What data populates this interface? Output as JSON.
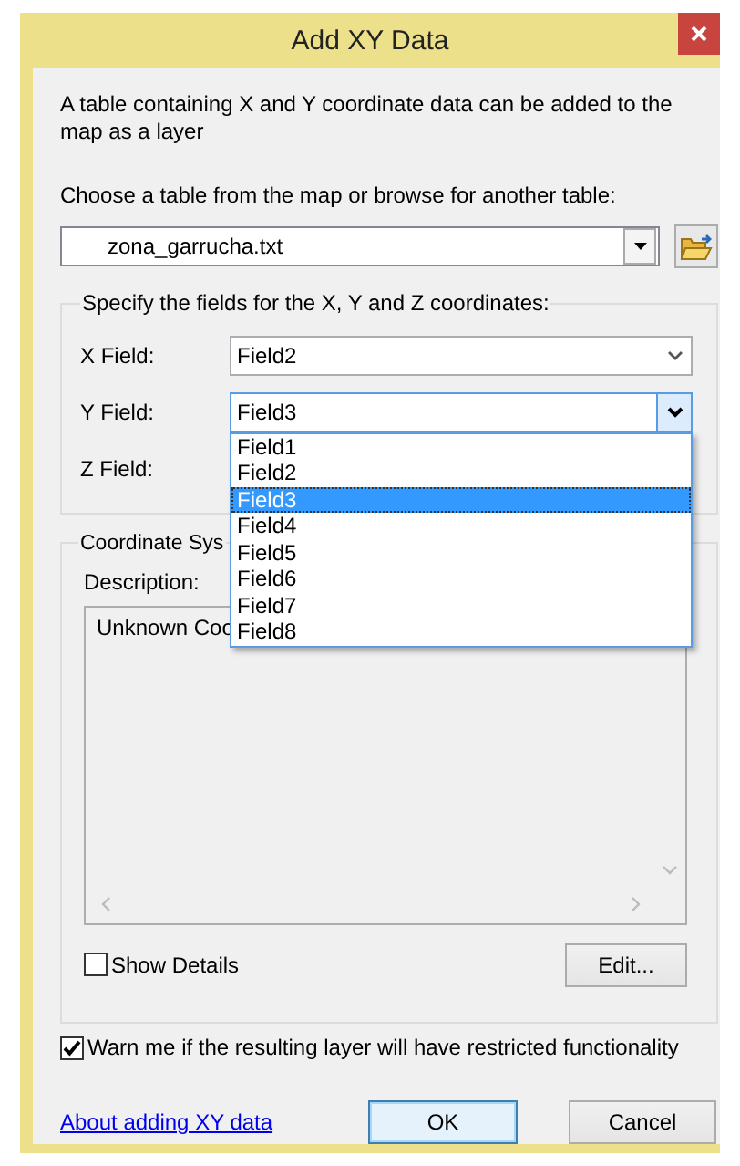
{
  "window": {
    "title": "Add XY Data"
  },
  "intro": "A table containing X and Y coordinate data can be added to the map as a layer",
  "table_prompt": "Choose a table from the map or browse for another table:",
  "table_combo": {
    "value": "zona_garrucha.txt"
  },
  "fields_group": {
    "title": "Specify the fields for the X, Y and Z coordinates:",
    "fields": [
      {
        "label": "X Field:",
        "value": "Field2",
        "focused": false
      },
      {
        "label": "Y Field:",
        "value": "Field3",
        "focused": true
      },
      {
        "label": "Z Field:"
      }
    ]
  },
  "dropdown": {
    "items": [
      {
        "label": "Field1",
        "selected": false
      },
      {
        "label": "Field2",
        "selected": false
      },
      {
        "label": "Field3",
        "selected": true
      },
      {
        "label": "Field4",
        "selected": false
      },
      {
        "label": "Field5",
        "selected": false
      },
      {
        "label": "Field6",
        "selected": false
      },
      {
        "label": "Field7",
        "selected": false
      },
      {
        "label": "Field8",
        "selected": false
      }
    ]
  },
  "coordinate_group": {
    "title": "Coordinate Sys",
    "description_label": "Description:",
    "description": "Unknown Coo"
  },
  "show_details": {
    "label": "Show Details",
    "checked": false
  },
  "edit_button": "Edit...",
  "warn": {
    "label": "Warn me if the resulting layer will have restricted functionality",
    "checked": true
  },
  "link": "About adding XY data",
  "buttons": [
    {
      "label": "OK",
      "default": true
    },
    {
      "label": "Cancel",
      "default": false
    }
  ]
}
